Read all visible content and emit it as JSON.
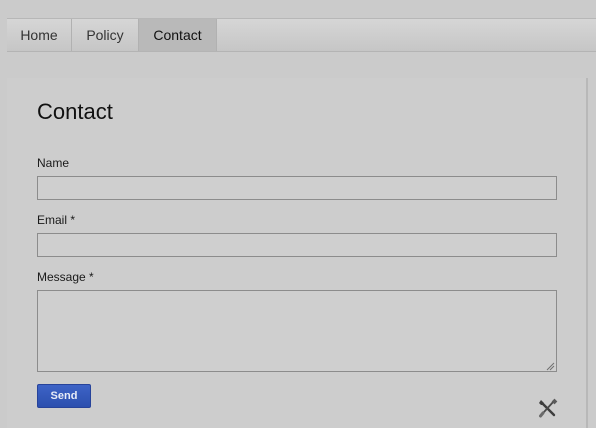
{
  "nav": {
    "tabs": [
      {
        "label": "Home"
      },
      {
        "label": "Policy"
      },
      {
        "label": "Contact",
        "active": true
      }
    ]
  },
  "form": {
    "title": "Contact",
    "name_label": "Name",
    "name_value": "",
    "email_label": "Email *",
    "email_value": "",
    "message_label": "Message *",
    "message_value": "",
    "send_label": "Send"
  },
  "colors": {
    "background": "#cbcbcb",
    "active_tab": "#b9b9b9",
    "send_button": "#3359bb"
  },
  "icons": {
    "footer": "tools-icon",
    "textarea_corner": "resize-grip-icon"
  }
}
